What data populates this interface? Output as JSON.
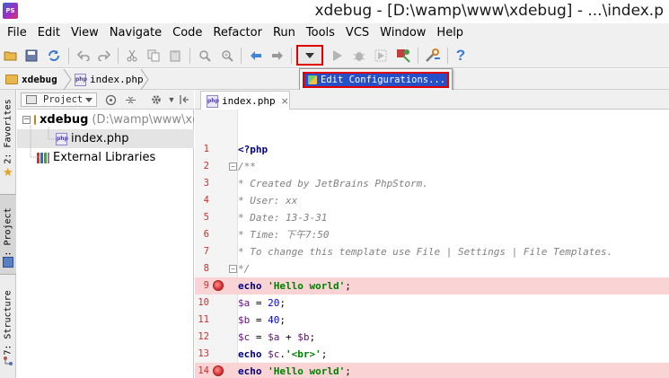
{
  "window": {
    "title": "xdebug - [D:\\wamp\\www\\xdebug] - ...\\index.p",
    "app_icon_label": "PS"
  },
  "menu": [
    "File",
    "Edit",
    "View",
    "Navigate",
    "Code",
    "Refactor",
    "Run",
    "Tools",
    "VCS",
    "Window",
    "Help"
  ],
  "toolbar": {
    "popup_item": "Edit Configurations...",
    "help_glyph": "?"
  },
  "navbar": {
    "project": "xdebug",
    "file": "index.php"
  },
  "left_tabs": {
    "favorites": "2: Favorites",
    "project": "1: Project",
    "structure": "7: Structure"
  },
  "project_panel": {
    "view_select": "Project",
    "tree": {
      "root_name": "xdebug",
      "root_path": "(D:\\wamp\\www\\xd",
      "file": "index.php",
      "libraries": "External Libraries"
    }
  },
  "editor": {
    "tab_label": "index.php",
    "tab_close": "×",
    "line_numbers": [
      "1",
      "2",
      "3",
      "4",
      "5",
      "6",
      "7",
      "8",
      "9",
      "10",
      "11",
      "12",
      "13",
      "14"
    ],
    "lines": {
      "l1": "<?php",
      "l2": "/**",
      "l3": " * Created by JetBrains PhpStorm.",
      "l4": " * User: xx",
      "l5": " * Date: 13-3-31",
      "l6": " * Time: 下午7:50",
      "l7": " * To change this template use File | Settings | File Templates.",
      "l8": " */",
      "l9_kw": "echo",
      "l9_str": "'Hello world'",
      "l9_end": ";",
      "l10_var": "$a",
      "l10_op": " = ",
      "l10_num": "20",
      "l10_end": ";",
      "l11_var": "$b",
      "l11_op": " = ",
      "l11_num": "40",
      "l11_end": ";",
      "l12_var1": "$c",
      "l12_op": " = ",
      "l12_var2": "$a",
      "l12_plus": " + ",
      "l12_var3": "$b",
      "l12_end": ";",
      "l13_kw": "echo",
      "l13_var": "$c",
      "l13_dot": ".",
      "l13_str": "'<br>'",
      "l13_end": ";",
      "l14_kw": "echo",
      "l14_str": "'Hello world'",
      "l14_end": ";"
    }
  },
  "colors": {
    "breakpoint_line": "#fad4d4",
    "highlight_border": "#e00000",
    "popup_selection": "#2550c8"
  }
}
